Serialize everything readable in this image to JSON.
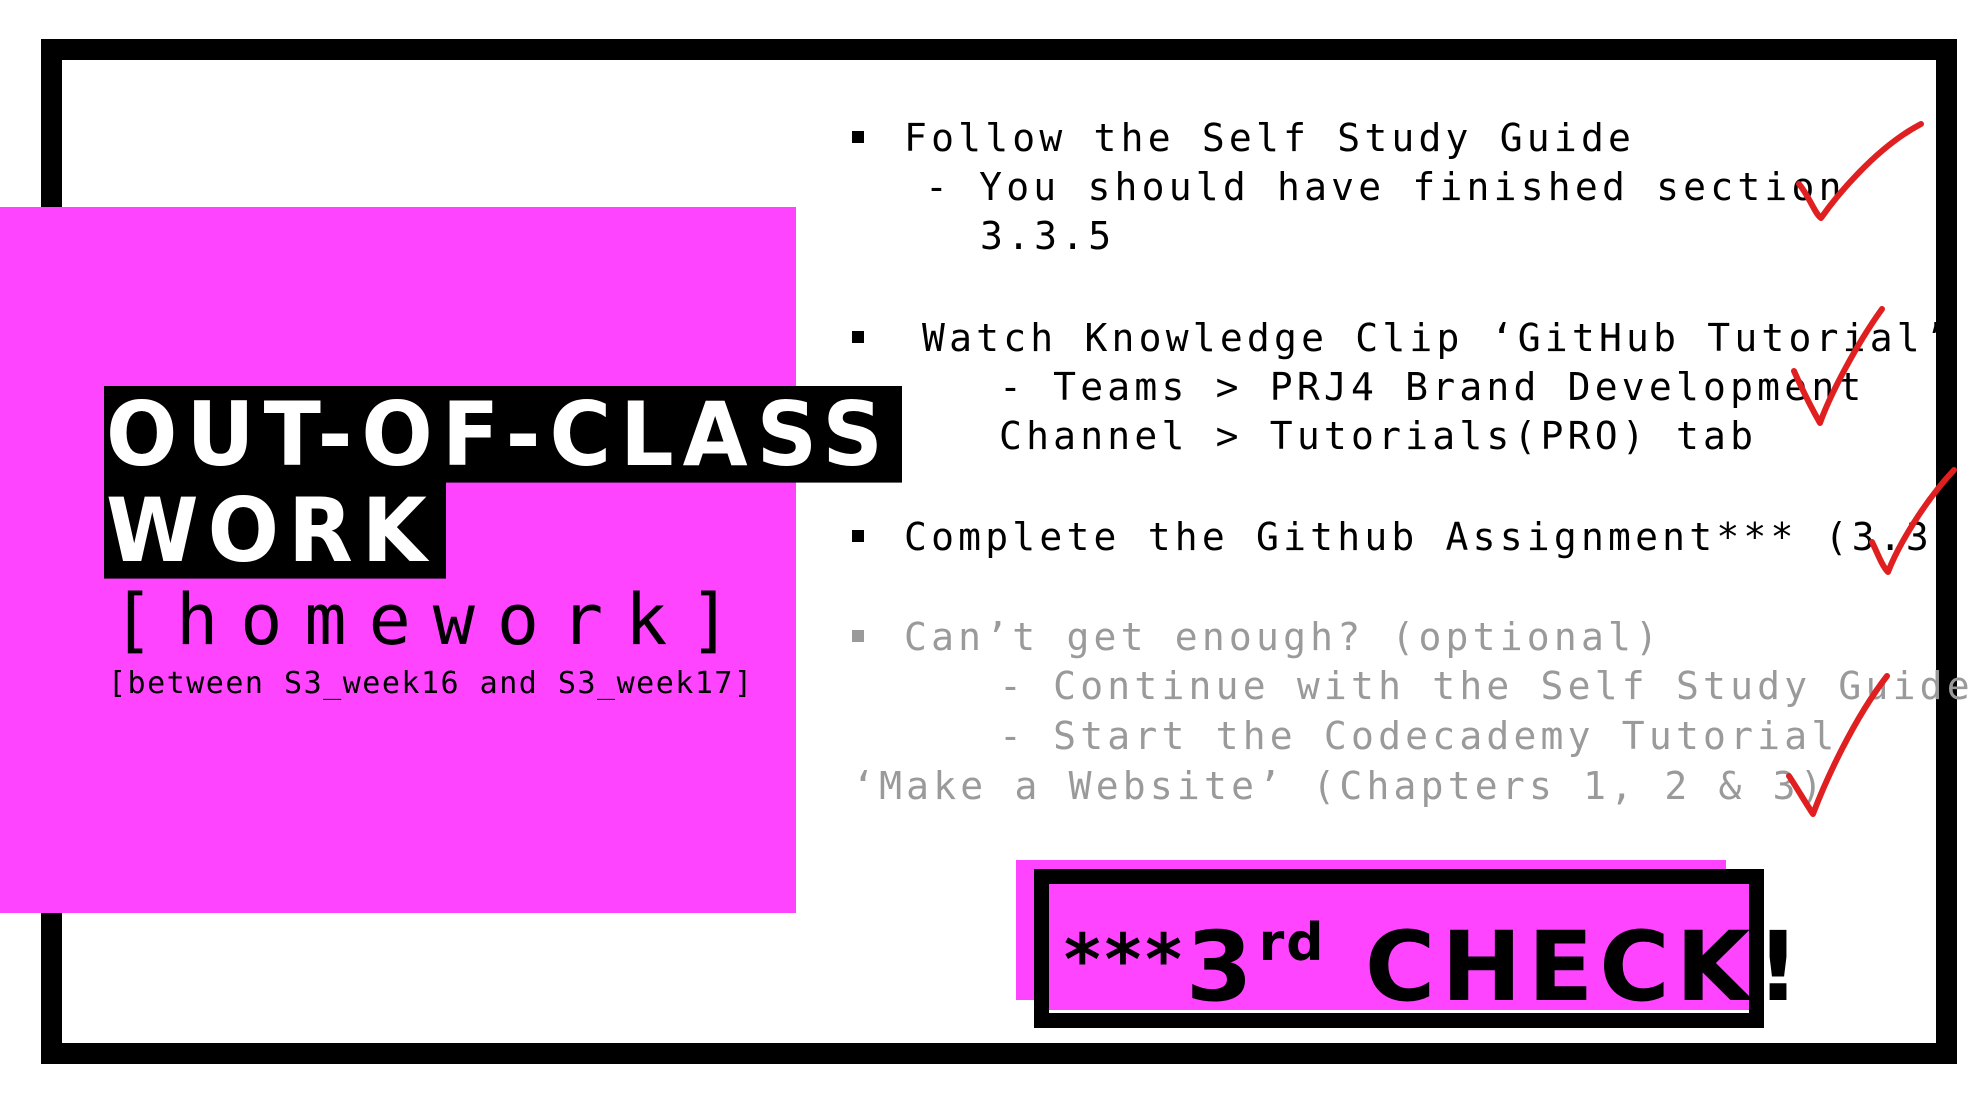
{
  "left_panel": {
    "title_line1": "OUT-OF-CLASS",
    "title_line2": "WORK",
    "subtitle": "[homework]",
    "date_range": "[between S3_week16 and S3_week17]"
  },
  "tasks": [
    {
      "label": "Follow the Self Study Guide",
      "sub_line1": "- You should have finished section",
      "sub_line2": "3.3.5",
      "checked": true
    },
    {
      "label": "Watch Knowledge Clip ‘GitHub Tutorial’",
      "sub_line1": "- Teams > PRJ4 Brand Development",
      "sub_line2": "Channel > Tutorials(PRO) tab",
      "checked": true
    },
    {
      "label": "Complete the Github Assignment*** (3.3)",
      "checked": true
    },
    {
      "label": "Can’t get enough? (optional)",
      "sub_line1": "- Continue with the Self Study Guide",
      "sub_line2": "- Start the Codecademy Tutorial",
      "sub_line3": "‘Make a Website’ (Chapters 1, 2 & 3)",
      "checked": true,
      "style": "optional"
    }
  ],
  "badge": {
    "stars": "***",
    "number": "3",
    "ordinal": "rd",
    "word": "CHECK!"
  },
  "colors": {
    "accent": "#ff44ff",
    "frame": "#000000",
    "check": "#e02020",
    "muted_text": "#9a9a9a"
  }
}
